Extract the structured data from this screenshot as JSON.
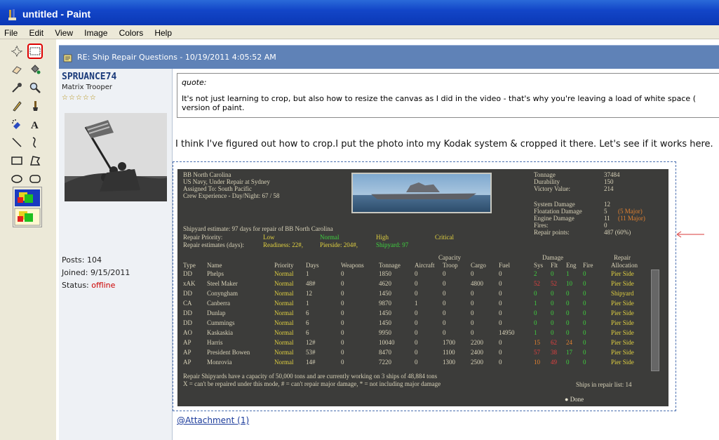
{
  "window": {
    "title": "untitled - Paint"
  },
  "menu": [
    "File",
    "Edit",
    "View",
    "Image",
    "Colors",
    "Help"
  ],
  "tools": [
    {
      "name": "free-select-icon"
    },
    {
      "name": "rect-select-icon",
      "selected": true
    },
    {
      "name": "eraser-icon"
    },
    {
      "name": "fill-icon"
    },
    {
      "name": "color-picker-icon"
    },
    {
      "name": "magnifier-icon"
    },
    {
      "name": "pencil-icon"
    },
    {
      "name": "brush-icon"
    },
    {
      "name": "airbrush-icon"
    },
    {
      "name": "text-icon"
    },
    {
      "name": "line-icon"
    },
    {
      "name": "curve-icon"
    },
    {
      "name": "rectangle-icon"
    },
    {
      "name": "polygon-icon"
    },
    {
      "name": "ellipse-icon"
    },
    {
      "name": "rounded-rect-icon"
    }
  ],
  "post": {
    "title": "RE: Ship Repair Questions - 10/19/2011 4:05:52 AM",
    "username": "SPRUANCE74",
    "rank": "Matrix Trooper",
    "stars": "☆☆☆☆☆",
    "posts": "Posts: 104",
    "joined": "Joined: 9/15/2011",
    "status_label": "Status: ",
    "status_value": "offline",
    "quote_label": "quote:",
    "quote_line1": "It's not just learning to crop, but also how to resize the canvas as I did in the video - that's why you're leaving a load of white space (",
    "quote_line2": "version of paint.",
    "body": "I think I've figured out how to crop.I put the photo into my Kodak system & cropped it there. Let's see if it works here.",
    "attachment": "Attachment (1)"
  },
  "game": {
    "header": [
      "BB North Carolina",
      "US Navy, Under Repair at Sydney",
      "Assigned To:     South Pacific",
      "Crew Experience - Day/Night:      67 / 58"
    ],
    "stats_labels": [
      "Tonnage",
      "Durability",
      "Victory Value:",
      "System Damage",
      "Floatation Damage",
      "Engine Damage",
      "Fires:",
      "Repair points:"
    ],
    "stats_values": [
      "37484",
      "150",
      "214",
      "12",
      "5",
      "11",
      "0",
      "487 (60%)"
    ],
    "stats_extra": [
      "",
      "",
      "",
      "",
      "(5 Major)",
      "(11 Major)",
      "",
      ""
    ],
    "estimate": "Shipyard estimate: 97 days for repair of BB North Carolina",
    "priority_label": "Repair Priority:",
    "priorities": [
      "Low",
      "Normal",
      "High",
      "Critical"
    ],
    "estimates_label": "Repair estimates (days):",
    "estimates": [
      "Readiness: 22#,",
      "Pierside: 204#,",
      "Shipyard: 97"
    ],
    "capacity_group": "Capacity",
    "damage_group": "Damage",
    "repair_group": "Repair",
    "columns": [
      "Type",
      "Name",
      "Priority",
      "Days",
      "Weapons",
      "Tonnage",
      "Aircraft",
      "Troop",
      "Cargo",
      "Fuel",
      "Sys",
      "Flt",
      "Eng",
      "Fire",
      "Allocation"
    ],
    "rows": [
      [
        "DD",
        "Phelps",
        "Normal",
        "1",
        "0",
        "1850",
        "0",
        "0",
        "0",
        "0",
        "2",
        "0",
        "1",
        "0",
        "Pier Side"
      ],
      [
        "xAK",
        "Steel Maker",
        "Normal",
        "48#",
        "0",
        "4620",
        "0",
        "0",
        "4800",
        "0",
        "52",
        "52",
        "10",
        "0",
        "Pier Side"
      ],
      [
        "DD",
        "Conyngham",
        "Normal",
        "12",
        "0",
        "1450",
        "0",
        "0",
        "0",
        "0",
        "0",
        "0",
        "0",
        "0",
        "Shipyard"
      ],
      [
        "CA",
        "Canberra",
        "Normal",
        "1",
        "0",
        "9870",
        "1",
        "0",
        "0",
        "0",
        "1",
        "0",
        "0",
        "0",
        "Pier Side"
      ],
      [
        "DD",
        "Dunlap",
        "Normal",
        "6",
        "0",
        "1450",
        "0",
        "0",
        "0",
        "0",
        "0",
        "0",
        "0",
        "0",
        "Pier Side"
      ],
      [
        "DD",
        "Cummings",
        "Normal",
        "6",
        "0",
        "1450",
        "0",
        "0",
        "0",
        "0",
        "0",
        "0",
        "0",
        "0",
        "Pier Side"
      ],
      [
        "AO",
        "Kaskaskia",
        "Normal",
        "6",
        "0",
        "9950",
        "0",
        "0",
        "0",
        "14950",
        "1",
        "0",
        "0",
        "0",
        "Pier Side"
      ],
      [
        "AP",
        "Harris",
        "Normal",
        "12#",
        "0",
        "10040",
        "0",
        "1700",
        "2200",
        "0",
        "15",
        "62",
        "24",
        "0",
        "Pier Side"
      ],
      [
        "AP",
        "President Bowen",
        "Normal",
        "53#",
        "0",
        "8470",
        "0",
        "1100",
        "2400",
        "0",
        "57",
        "38",
        "17",
        "0",
        "Pier Side"
      ],
      [
        "AP",
        "Monrovia",
        "Normal",
        "14#",
        "0",
        "7220",
        "0",
        "1300",
        "2500",
        "0",
        "10",
        "49",
        "0",
        "0",
        "Pier Side"
      ]
    ],
    "footer1": "Repair Shipyards have a capacity of 50,000 tons and are currently working on 3 ships of 48,884 tons",
    "footer2": "X = can't be repaired under this mode, # = can't repair major damage, * = not including major damage",
    "ships_in_list": "Ships in repair list: 14",
    "done": "Done"
  },
  "colors": {
    "title_bar": "#1346c8",
    "post_bar": "#5f82b7",
    "game_bg": "#3c3c3a",
    "green": "#3fd13f",
    "yellow": "#e0d040",
    "red": "#e04040",
    "orange": "#e08030",
    "arrow": "#e06060"
  }
}
